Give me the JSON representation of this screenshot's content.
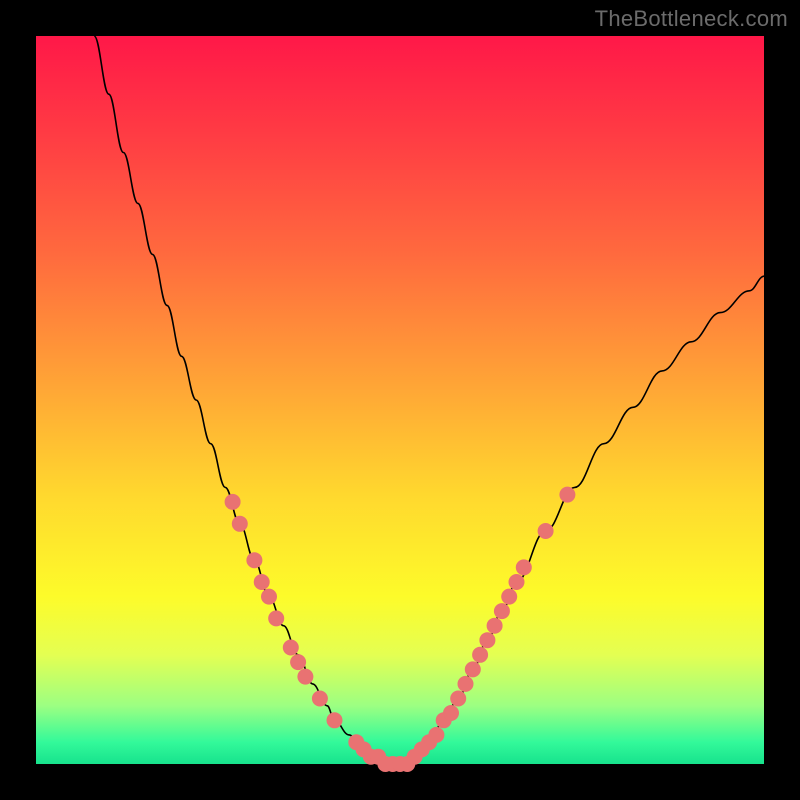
{
  "watermark": "TheBottleneck.com",
  "colors": {
    "frame": "#000000",
    "curve_stroke": "#000000",
    "marker_fill": "#e97272",
    "gradient_stops": [
      "#ff1848",
      "#ff3a44",
      "#ff6a3e",
      "#ffa536",
      "#ffd82e",
      "#fdfb2a",
      "#e4ff52",
      "#9cff82",
      "#33f99a",
      "#17e38d"
    ]
  },
  "chart_data": {
    "type": "line",
    "title": "",
    "xlabel": "",
    "ylabel": "",
    "xlim": [
      0,
      100
    ],
    "ylim": [
      0,
      100
    ],
    "grid": false,
    "legend": false,
    "series": [
      {
        "name": "curve",
        "x": [
          8,
          10,
          12,
          14,
          16,
          18,
          20,
          22,
          24,
          26,
          28,
          30,
          32,
          34,
          36,
          38,
          40,
          41,
          43,
          45,
          46,
          48,
          50,
          52,
          54,
          56,
          58,
          60,
          62,
          64,
          66,
          70,
          74,
          78,
          82,
          86,
          90,
          94,
          98,
          100
        ],
        "y": [
          100,
          92,
          84,
          77,
          70,
          63,
          56,
          50,
          44,
          38,
          33,
          28,
          23,
          19,
          15,
          11,
          8,
          6,
          4,
          2,
          1,
          0,
          0,
          1,
          3,
          6,
          9,
          13,
          17,
          21,
          25,
          32,
          38,
          44,
          49,
          54,
          58,
          62,
          65,
          67
        ]
      }
    ],
    "markers": [
      {
        "x": 27,
        "y": 36
      },
      {
        "x": 28,
        "y": 33
      },
      {
        "x": 30,
        "y": 28
      },
      {
        "x": 31,
        "y": 25
      },
      {
        "x": 32,
        "y": 23
      },
      {
        "x": 33,
        "y": 20
      },
      {
        "x": 35,
        "y": 16
      },
      {
        "x": 36,
        "y": 14
      },
      {
        "x": 37,
        "y": 12
      },
      {
        "x": 39,
        "y": 9
      },
      {
        "x": 41,
        "y": 6
      },
      {
        "x": 44,
        "y": 3
      },
      {
        "x": 45,
        "y": 2
      },
      {
        "x": 46,
        "y": 1
      },
      {
        "x": 47,
        "y": 1
      },
      {
        "x": 48,
        "y": 0
      },
      {
        "x": 49,
        "y": 0
      },
      {
        "x": 50,
        "y": 0
      },
      {
        "x": 51,
        "y": 0
      },
      {
        "x": 52,
        "y": 1
      },
      {
        "x": 53,
        "y": 2
      },
      {
        "x": 54,
        "y": 3
      },
      {
        "x": 55,
        "y": 4
      },
      {
        "x": 56,
        "y": 6
      },
      {
        "x": 57,
        "y": 7
      },
      {
        "x": 58,
        "y": 9
      },
      {
        "x": 59,
        "y": 11
      },
      {
        "x": 60,
        "y": 13
      },
      {
        "x": 61,
        "y": 15
      },
      {
        "x": 62,
        "y": 17
      },
      {
        "x": 63,
        "y": 19
      },
      {
        "x": 64,
        "y": 21
      },
      {
        "x": 65,
        "y": 23
      },
      {
        "x": 66,
        "y": 25
      },
      {
        "x": 67,
        "y": 27
      },
      {
        "x": 70,
        "y": 32
      },
      {
        "x": 73,
        "y": 37
      }
    ]
  }
}
